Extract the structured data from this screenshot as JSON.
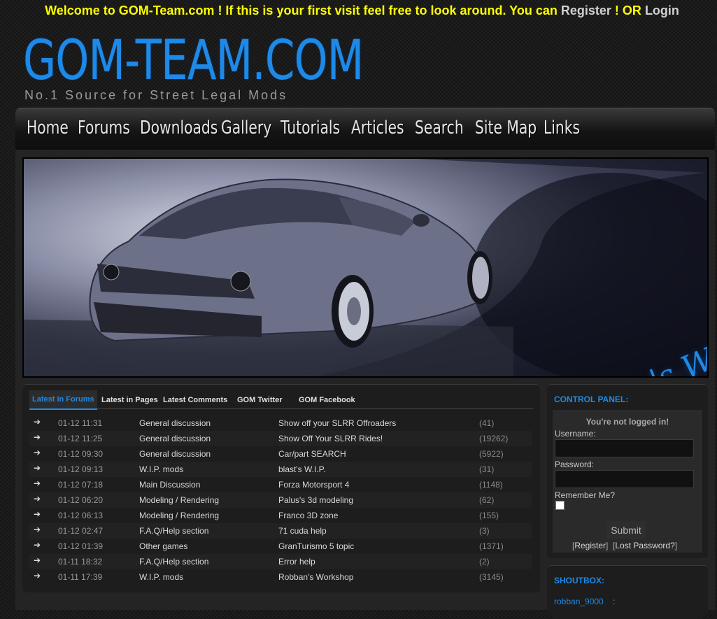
{
  "header": {
    "welcome_text": "Welcome to GOM-Team.com ! If this is your first visit feel free to look around. You can",
    "register_link": "Register",
    "separator": "! OR",
    "login_link": "Login",
    "logo_title": "GOM-TEAM.COM",
    "logo_tagline": "No.1 Source for Street Legal Mods"
  },
  "nav": {
    "items": [
      "Home",
      "Forums",
      "Downloads",
      "Gallery",
      "Tutorials",
      "Articles",
      "Search",
      "Site Map",
      "Links"
    ]
  },
  "banner": {
    "caption": "Franco's W.I.P."
  },
  "forum_panel": {
    "tabs": [
      "Latest in Forums",
      "Latest in Pages",
      "Latest Comments",
      "GOM Twitter",
      "GOM Facebook"
    ],
    "active_tab": "Latest in Forums",
    "arrow_icon": "arrow-right-icon",
    "rows": [
      {
        "date": "01-12 11:31",
        "forum": "General discussion",
        "topic": "Show off your SLRR Offroaders",
        "count": "(41)"
      },
      {
        "date": "01-12 11:25",
        "forum": "General discussion",
        "topic": "Show Off Your SLRR Rides!",
        "count": "(19262)"
      },
      {
        "date": "01-12 09:30",
        "forum": "General discussion",
        "topic": "Car/part SEARCH",
        "count": "(5922)"
      },
      {
        "date": "01-12 09:13",
        "forum": "W.I.P. mods",
        "topic": "blast's W.I.P.",
        "count": "(31)"
      },
      {
        "date": "01-12 07:18",
        "forum": "Main Discussion",
        "topic": "Forza Motorsport 4",
        "count": "(1148)"
      },
      {
        "date": "01-12 06:20",
        "forum": "Modeling / Rendering",
        "topic": "Palus's 3d modeling",
        "count": "(62)"
      },
      {
        "date": "01-12 06:13",
        "forum": "Modeling / Rendering",
        "topic": "Franco 3D zone",
        "count": "(155)"
      },
      {
        "date": "01-12 02:47",
        "forum": "F.A.Q/Help section",
        "topic": "71 cuda help",
        "count": "(3)"
      },
      {
        "date": "01-12 01:39",
        "forum": "Other games",
        "topic": "GranTurismo 5 topic",
        "count": "(1371)"
      },
      {
        "date": "01-11 18:32",
        "forum": "F.A.Q/Help section",
        "topic": "Error help",
        "count": "(2)"
      },
      {
        "date": "01-11 17:39",
        "forum": "W.I.P. mods",
        "topic": "Robban's Workshop",
        "count": "(3145)"
      }
    ]
  },
  "control_panel": {
    "title": "CONTROL PANEL:",
    "status": "You're not logged in!",
    "username_label": "Username:",
    "password_label": "Password:",
    "remember_label": "Remember Me?",
    "submit_label": "Submit",
    "register_link": "Register",
    "lost_password_link": "Lost Password?"
  },
  "shoutbox": {
    "title": "SHOUTBOX:",
    "user": "robban_9000",
    "separator": ":"
  },
  "colors": {
    "accent": "#1e8ae8",
    "welcome": "#ffff00"
  }
}
